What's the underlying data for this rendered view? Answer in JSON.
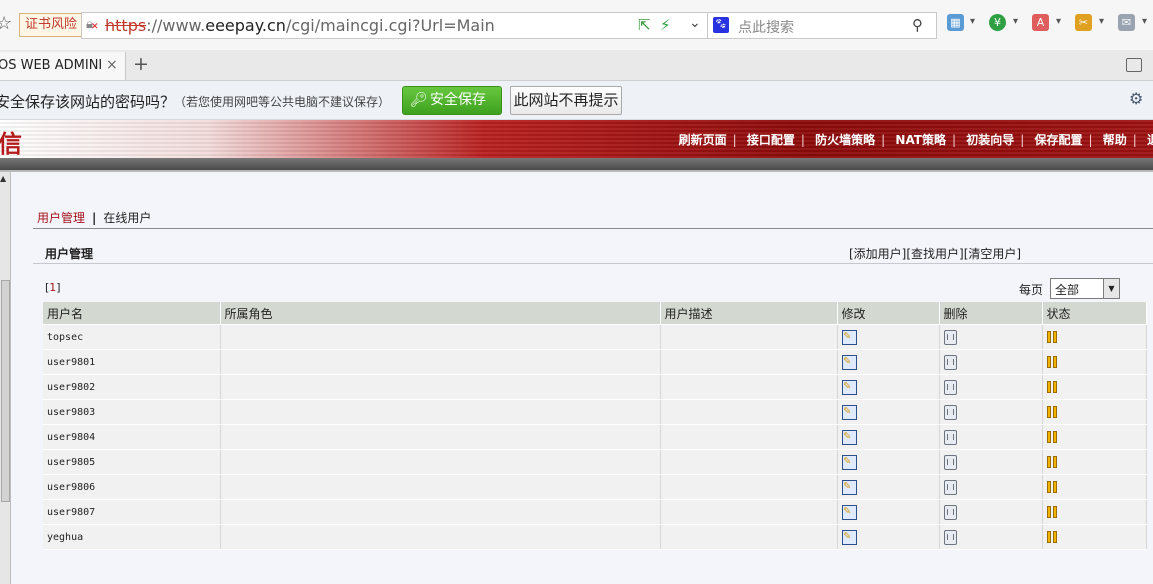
{
  "browser": {
    "cert_warning": "证书风险",
    "url": {
      "scheme": "https",
      "rest": "://www.",
      "host": "eeepay.cn",
      "path": "/cgi/maincgi.cgi?Url=Main"
    },
    "search_placeholder": "点此搜索",
    "search_engine_icon": "baidu-paw-icon",
    "tab_title": "OS WEB ADMINI",
    "new_tab": "+"
  },
  "password_bar": {
    "question": "安全保存该网站的密码吗？",
    "hint": "（若您使用网吧等公共电脑不建议保存）",
    "save_label": "安全保存",
    "never_label": "此网站不再提示"
  },
  "header": {
    "logo_fragment": "信",
    "nav": [
      "刷新页面",
      "接口配置",
      "防火墙策略",
      "NAT策略",
      "初装向导",
      "保存配置",
      "帮助",
      "退"
    ]
  },
  "breadcrumb": {
    "current": "用户管理",
    "separator": "|",
    "next": "在线用户"
  },
  "section": {
    "title": "用户管理",
    "actions": [
      "[添加用户]",
      "[查找用户]",
      "[清空用户]"
    ]
  },
  "pagination": {
    "index": "1",
    "per_page_label": "每页",
    "per_page_value": "全部"
  },
  "table": {
    "columns": [
      "用户名",
      "所属角色",
      "用户描述",
      "修改",
      "删除",
      "状态"
    ],
    "rows": [
      {
        "username": "topsec",
        "role": "",
        "description": ""
      },
      {
        "username": "user9801",
        "role": "",
        "description": ""
      },
      {
        "username": "user9802",
        "role": "",
        "description": ""
      },
      {
        "username": "user9803",
        "role": "",
        "description": ""
      },
      {
        "username": "user9804",
        "role": "",
        "description": ""
      },
      {
        "username": "user9805",
        "role": "",
        "description": ""
      },
      {
        "username": "user9806",
        "role": "",
        "description": ""
      },
      {
        "username": "user9807",
        "role": "",
        "description": ""
      },
      {
        "username": "yeghua",
        "role": "",
        "description": ""
      }
    ]
  },
  "colors": {
    "accent": "#a3151b",
    "header_red": "#8c0a0a",
    "save_green": "#3ea11e",
    "table_header": "#d3d8d1"
  }
}
